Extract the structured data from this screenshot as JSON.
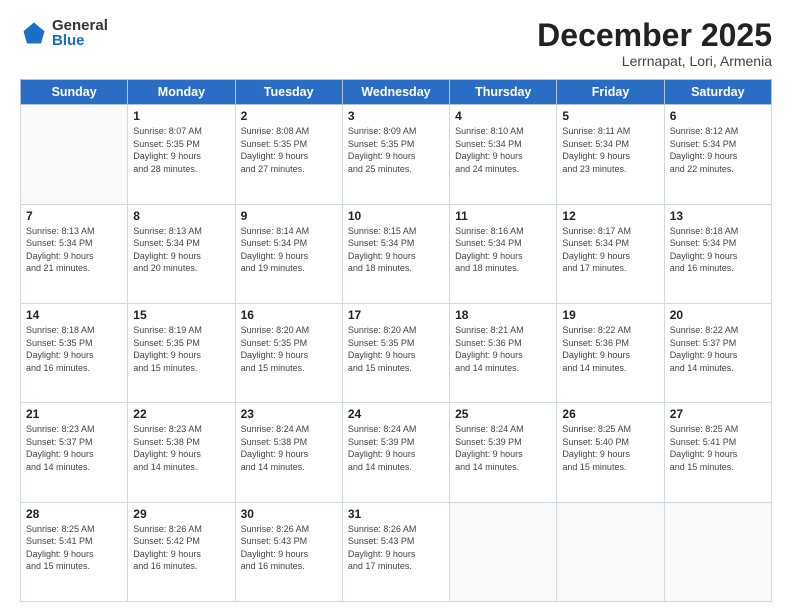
{
  "logo": {
    "general": "General",
    "blue": "Blue"
  },
  "header": {
    "month": "December 2025",
    "location": "Lerrnapat, Lori, Armenia"
  },
  "weekdays": [
    "Sunday",
    "Monday",
    "Tuesday",
    "Wednesday",
    "Thursday",
    "Friday",
    "Saturday"
  ],
  "weeks": [
    [
      {
        "day": "",
        "info": ""
      },
      {
        "day": "1",
        "info": "Sunrise: 8:07 AM\nSunset: 5:35 PM\nDaylight: 9 hours\nand 28 minutes."
      },
      {
        "day": "2",
        "info": "Sunrise: 8:08 AM\nSunset: 5:35 PM\nDaylight: 9 hours\nand 27 minutes."
      },
      {
        "day": "3",
        "info": "Sunrise: 8:09 AM\nSunset: 5:35 PM\nDaylight: 9 hours\nand 25 minutes."
      },
      {
        "day": "4",
        "info": "Sunrise: 8:10 AM\nSunset: 5:34 PM\nDaylight: 9 hours\nand 24 minutes."
      },
      {
        "day": "5",
        "info": "Sunrise: 8:11 AM\nSunset: 5:34 PM\nDaylight: 9 hours\nand 23 minutes."
      },
      {
        "day": "6",
        "info": "Sunrise: 8:12 AM\nSunset: 5:34 PM\nDaylight: 9 hours\nand 22 minutes."
      }
    ],
    [
      {
        "day": "7",
        "info": "Sunrise: 8:13 AM\nSunset: 5:34 PM\nDaylight: 9 hours\nand 21 minutes."
      },
      {
        "day": "8",
        "info": "Sunrise: 8:13 AM\nSunset: 5:34 PM\nDaylight: 9 hours\nand 20 minutes."
      },
      {
        "day": "9",
        "info": "Sunrise: 8:14 AM\nSunset: 5:34 PM\nDaylight: 9 hours\nand 19 minutes."
      },
      {
        "day": "10",
        "info": "Sunrise: 8:15 AM\nSunset: 5:34 PM\nDaylight: 9 hours\nand 18 minutes."
      },
      {
        "day": "11",
        "info": "Sunrise: 8:16 AM\nSunset: 5:34 PM\nDaylight: 9 hours\nand 18 minutes."
      },
      {
        "day": "12",
        "info": "Sunrise: 8:17 AM\nSunset: 5:34 PM\nDaylight: 9 hours\nand 17 minutes."
      },
      {
        "day": "13",
        "info": "Sunrise: 8:18 AM\nSunset: 5:34 PM\nDaylight: 9 hours\nand 16 minutes."
      }
    ],
    [
      {
        "day": "14",
        "info": "Sunrise: 8:18 AM\nSunset: 5:35 PM\nDaylight: 9 hours\nand 16 minutes."
      },
      {
        "day": "15",
        "info": "Sunrise: 8:19 AM\nSunset: 5:35 PM\nDaylight: 9 hours\nand 15 minutes."
      },
      {
        "day": "16",
        "info": "Sunrise: 8:20 AM\nSunset: 5:35 PM\nDaylight: 9 hours\nand 15 minutes."
      },
      {
        "day": "17",
        "info": "Sunrise: 8:20 AM\nSunset: 5:35 PM\nDaylight: 9 hours\nand 15 minutes."
      },
      {
        "day": "18",
        "info": "Sunrise: 8:21 AM\nSunset: 5:36 PM\nDaylight: 9 hours\nand 14 minutes."
      },
      {
        "day": "19",
        "info": "Sunrise: 8:22 AM\nSunset: 5:36 PM\nDaylight: 9 hours\nand 14 minutes."
      },
      {
        "day": "20",
        "info": "Sunrise: 8:22 AM\nSunset: 5:37 PM\nDaylight: 9 hours\nand 14 minutes."
      }
    ],
    [
      {
        "day": "21",
        "info": "Sunrise: 8:23 AM\nSunset: 5:37 PM\nDaylight: 9 hours\nand 14 minutes."
      },
      {
        "day": "22",
        "info": "Sunrise: 8:23 AM\nSunset: 5:38 PM\nDaylight: 9 hours\nand 14 minutes."
      },
      {
        "day": "23",
        "info": "Sunrise: 8:24 AM\nSunset: 5:38 PM\nDaylight: 9 hours\nand 14 minutes."
      },
      {
        "day": "24",
        "info": "Sunrise: 8:24 AM\nSunset: 5:39 PM\nDaylight: 9 hours\nand 14 minutes."
      },
      {
        "day": "25",
        "info": "Sunrise: 8:24 AM\nSunset: 5:39 PM\nDaylight: 9 hours\nand 14 minutes."
      },
      {
        "day": "26",
        "info": "Sunrise: 8:25 AM\nSunset: 5:40 PM\nDaylight: 9 hours\nand 15 minutes."
      },
      {
        "day": "27",
        "info": "Sunrise: 8:25 AM\nSunset: 5:41 PM\nDaylight: 9 hours\nand 15 minutes."
      }
    ],
    [
      {
        "day": "28",
        "info": "Sunrise: 8:25 AM\nSunset: 5:41 PM\nDaylight: 9 hours\nand 15 minutes."
      },
      {
        "day": "29",
        "info": "Sunrise: 8:26 AM\nSunset: 5:42 PM\nDaylight: 9 hours\nand 16 minutes."
      },
      {
        "day": "30",
        "info": "Sunrise: 8:26 AM\nSunset: 5:43 PM\nDaylight: 9 hours\nand 16 minutes."
      },
      {
        "day": "31",
        "info": "Sunrise: 8:26 AM\nSunset: 5:43 PM\nDaylight: 9 hours\nand 17 minutes."
      },
      {
        "day": "",
        "info": ""
      },
      {
        "day": "",
        "info": ""
      },
      {
        "day": "",
        "info": ""
      }
    ]
  ]
}
